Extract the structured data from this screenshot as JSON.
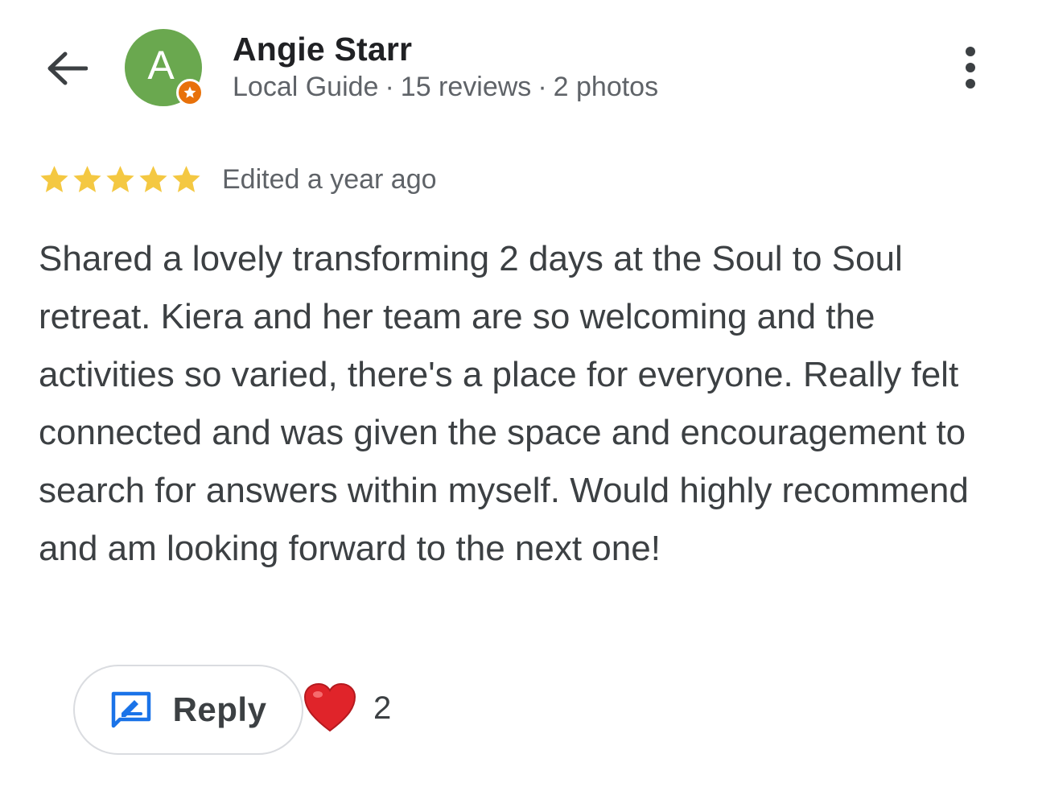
{
  "header": {
    "back_icon": "arrow-left-icon",
    "avatar_letter": "A",
    "avatar_color": "#6aa84f",
    "badge_color": "#e8710a",
    "user_name": "Angie Starr",
    "meta": {
      "role": "Local Guide",
      "reviews": "15 reviews",
      "photos": "2 photos",
      "separator": "·"
    },
    "more_icon": "more-vertical-icon"
  },
  "review": {
    "rating": 5,
    "rating_max": 5,
    "star_color": "#f4c842",
    "edited_label": "Edited a year ago",
    "text": "Shared a lovely transforming 2 days at the Soul to Soul retreat. Kiera and her team are so welcoming and the activities so varied, there's a place for everyone. Really felt connected and was given the space and encouragement to search for answers within myself. Would highly recommend and am looking forward to the next one!"
  },
  "actions": {
    "reply_label": "Reply",
    "reply_icon": "reply-edit-icon",
    "reply_icon_color": "#1a73e8",
    "reaction_icon": "heart-icon",
    "reaction_color": "#e0242a",
    "reaction_count": "2"
  }
}
